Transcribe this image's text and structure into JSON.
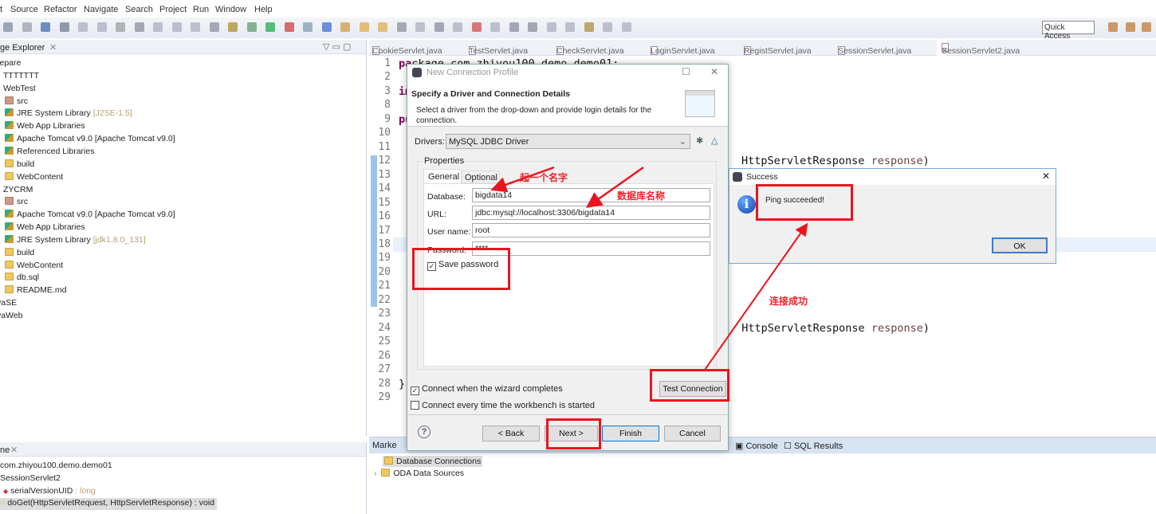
{
  "menu": [
    "t",
    "Source",
    "Refactor",
    "Navigate",
    "Search",
    "Project",
    "Run",
    "Window",
    "Help"
  ],
  "toolbar": {
    "quick_access": "Quick Access"
  },
  "package_explorer": {
    "title": "ge Explorer",
    "items": [
      {
        "label": "repare",
        "indent": 0
      },
      {
        "label": "TTTTTTT",
        "indent": 1
      },
      {
        "label": "WebTest",
        "indent": 1
      },
      {
        "label": "src",
        "indent": 2,
        "icon": "package"
      },
      {
        "label": "JRE System Library",
        "suffix": "[J2SE-1.5]",
        "indent": 2,
        "icon": "library"
      },
      {
        "label": "Web App Libraries",
        "indent": 2,
        "icon": "library"
      },
      {
        "label": "Apache Tomcat v9.0 [Apache Tomcat v9.0]",
        "indent": 2,
        "icon": "library"
      },
      {
        "label": "Referenced Libraries",
        "indent": 2,
        "icon": "library"
      },
      {
        "label": "build",
        "indent": 2,
        "icon": "folder"
      },
      {
        "label": "WebContent",
        "indent": 2,
        "icon": "folder"
      },
      {
        "label": "ZYCRM",
        "indent": 1
      },
      {
        "label": "src",
        "indent": 2,
        "icon": "package"
      },
      {
        "label": "Apache Tomcat v9.0 [Apache Tomcat v9.0]",
        "indent": 2,
        "icon": "library"
      },
      {
        "label": "Web App Libraries",
        "indent": 2,
        "icon": "library"
      },
      {
        "label": "JRE System Library",
        "suffix": "[jdk1.8.0_131]",
        "indent": 2,
        "icon": "library"
      },
      {
        "label": "build",
        "indent": 2,
        "icon": "folder"
      },
      {
        "label": "WebContent",
        "indent": 2,
        "icon": "folder"
      },
      {
        "label": "db.sql",
        "indent": 2,
        "icon": "file"
      },
      {
        "label": "README.md",
        "indent": 2,
        "icon": "file"
      },
      {
        "label": "vaSE",
        "indent": 0
      },
      {
        "label": "vaWeb",
        "indent": 0
      }
    ]
  },
  "outline": {
    "title": "ne",
    "items": [
      {
        "label": "com.zhiyou100.demo.demo01"
      },
      {
        "label": "SessionServlet2"
      },
      {
        "label": "serialVersionUID",
        "suffix": " : long"
      },
      {
        "label": "doGet(HttpServletRequest, HttpServletResponse) : void"
      }
    ]
  },
  "editor": {
    "tabs": [
      "CookieServlet.java",
      "TestServlet.java",
      "CheckServlet.java",
      "LoginServlet.java",
      "RegistServlet.java",
      "SessionServlet.java",
      "SessionServlet2.java"
    ],
    "active_tab": 6,
    "line_numbers": [
      "1",
      "2",
      "3",
      "8",
      "9",
      "10",
      "11",
      "12",
      "13",
      "14",
      "15",
      "16",
      "17",
      "18",
      "19",
      "20",
      "21",
      "22",
      "23",
      "24",
      "25",
      "26",
      "27",
      "28",
      "29"
    ],
    "code_fragments": {
      "l1_kw": "pa",
      "l1_rest": "ckage com.zhiyou100.demo.demo01;",
      "l3": "im",
      "l9": "pu",
      "l12": "HttpServletResponse",
      "l12p": "response",
      "l24": ", HttpServletResponse",
      "l24p": "response",
      "l28": "}"
    }
  },
  "bottom": {
    "tab_markers": "Marke",
    "tab_console": "Console",
    "tab_sql": "SQL Results",
    "items": [
      "Database Connections",
      "ODA Data Sources"
    ]
  },
  "dialog": {
    "title": "New Connection Profile",
    "heading": "Specify a Driver and Connection Details",
    "description": "Select a driver from the drop-down and provide login details for the connection.",
    "drivers_label": "Drivers:",
    "driver_value": "MySQL JDBC Driver",
    "properties_label": "Properties",
    "tabs": [
      "General",
      "Optional"
    ],
    "fields": [
      {
        "label": "Database:",
        "value": "bigdata14"
      },
      {
        "label": "URL:",
        "value": "jdbc:mysql://localhost:3306/bigdata14"
      },
      {
        "label": "User name:",
        "value": "root"
      },
      {
        "label": "Password:",
        "value": "****"
      }
    ],
    "save_password": {
      "label": "Save password",
      "checked": true
    },
    "connect_on_finish": {
      "label": "Connect when the wizard completes",
      "checked": true
    },
    "connect_on_start": {
      "label": "Connect every time the workbench is started",
      "checked": false
    },
    "test_connection": "Test Connection",
    "back": "< Back",
    "next": "Next >",
    "finish": "Finish",
    "cancel": "Cancel"
  },
  "success": {
    "title": "Success",
    "message": "Ping succeeded!",
    "ok": "OK"
  },
  "annotations": {
    "name_it": "起一个名字",
    "db_name": "数据库名称",
    "connected": "连接成功",
    "color": "#e8151f"
  }
}
